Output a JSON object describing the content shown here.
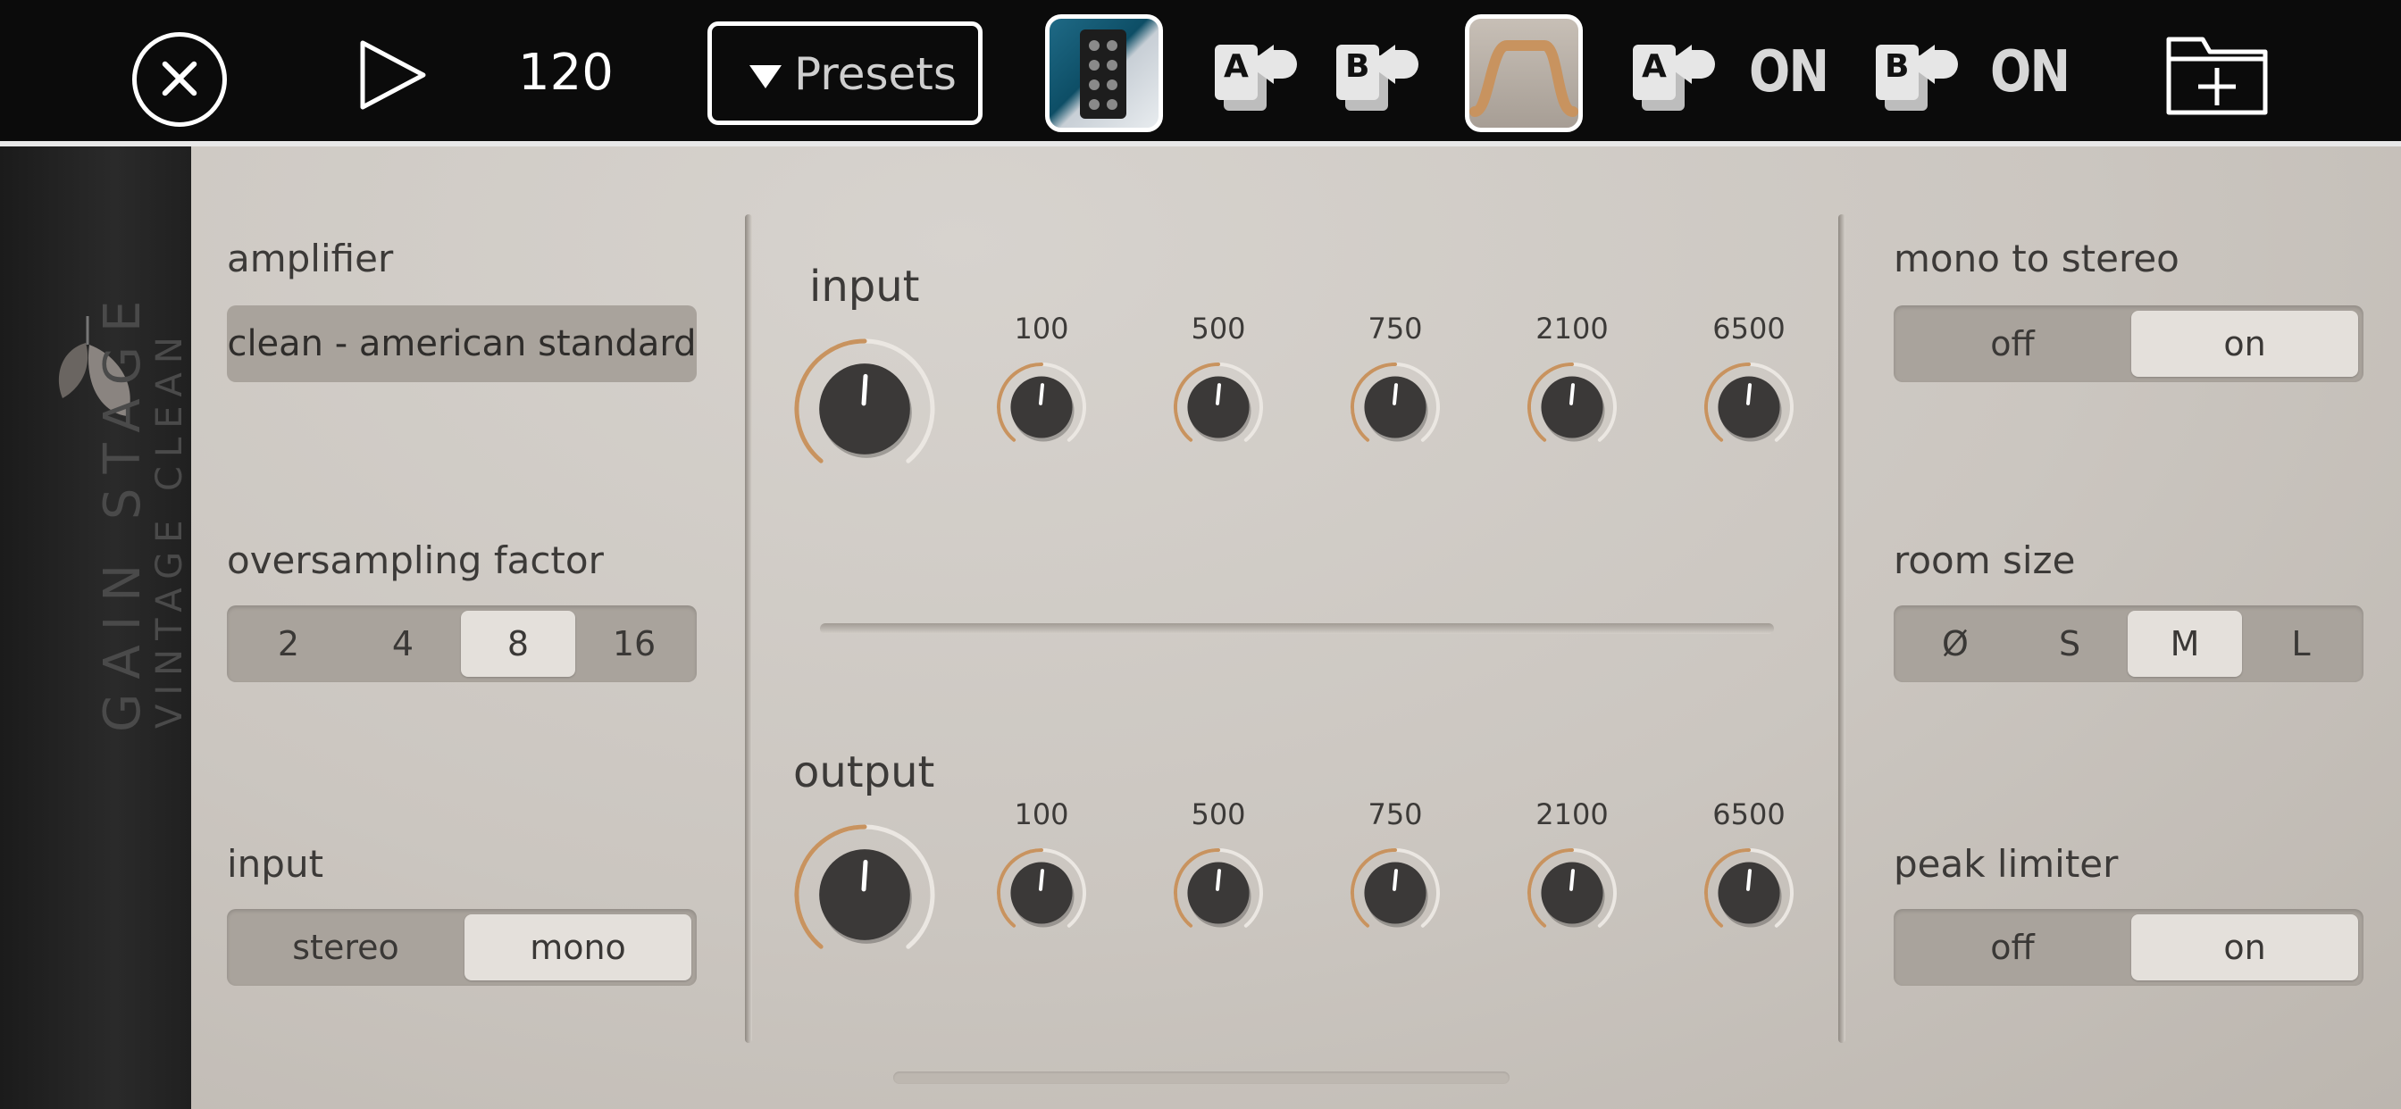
{
  "toolbar": {
    "close_icon": "close-icon",
    "play_icon": "play-icon",
    "tempo": "120",
    "presets_label": "Presets",
    "ab_a_label": "A",
    "ab_b_label": "B",
    "a_on_label": "ON",
    "b_on_label": "ON",
    "folder_icon": "folder-add-icon"
  },
  "brand": {
    "name": "GAIN STAGE",
    "subtitle": "VINTAGE CLEAN"
  },
  "left": {
    "amplifier_label": "amplifier",
    "amplifier_value": "clean - american standard",
    "oversampling_label": "oversampling factor",
    "oversampling_options": [
      "2",
      "4",
      "8",
      "16"
    ],
    "oversampling_selected": "8",
    "input_label": "input",
    "input_options": [
      "stereo",
      "mono"
    ],
    "input_selected": "mono"
  },
  "center": {
    "input_label": "input",
    "output_label": "output",
    "bands": [
      "100",
      "500",
      "750",
      "2100",
      "6500"
    ]
  },
  "right": {
    "mono_to_stereo_label": "mono to stereo",
    "mono_to_stereo_options": [
      "off",
      "on"
    ],
    "mono_to_stereo_selected": "on",
    "room_size_label": "room size",
    "room_size_options": [
      "Ø",
      "S",
      "M",
      "L"
    ],
    "room_size_selected": "M",
    "peak_limiter_label": "peak limiter",
    "peak_limiter_options": [
      "off",
      "on"
    ],
    "peak_limiter_selected": "on"
  },
  "colors": {
    "accent": "#c8935f",
    "panel": "#cfcac4",
    "knob": "#3b3938",
    "segment": "#a9a39c"
  }
}
